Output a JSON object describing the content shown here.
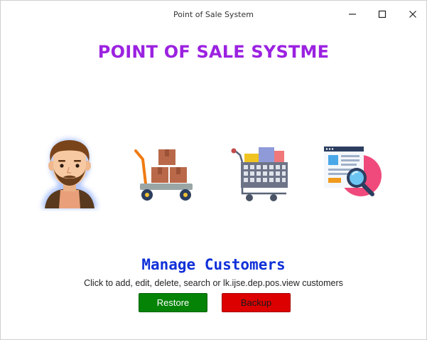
{
  "window": {
    "title": "Point of Sale System",
    "controls": [
      "minimize-icon",
      "maximize-icon",
      "close-icon"
    ]
  },
  "app": {
    "title": "POINT OF SALE SYSTME"
  },
  "menu": {
    "items": [
      {
        "name": "customer",
        "icon": "customer-avatar-icon"
      },
      {
        "name": "items",
        "icon": "hand-truck-boxes-icon"
      },
      {
        "name": "orders",
        "icon": "shopping-cart-icon"
      },
      {
        "name": "search",
        "icon": "web-page-search-icon"
      }
    ]
  },
  "section": {
    "title": "Manage Customers",
    "description": "Click to add, edit, delete, search or lk.ijse.dep.pos.view customers"
  },
  "buttons": {
    "restore_label": "Restore",
    "backup_label": "Backup"
  },
  "colors": {
    "title": "#9b22e0",
    "section_title": "#1030d8",
    "restore": "#048307",
    "backup": "#dd0000"
  }
}
